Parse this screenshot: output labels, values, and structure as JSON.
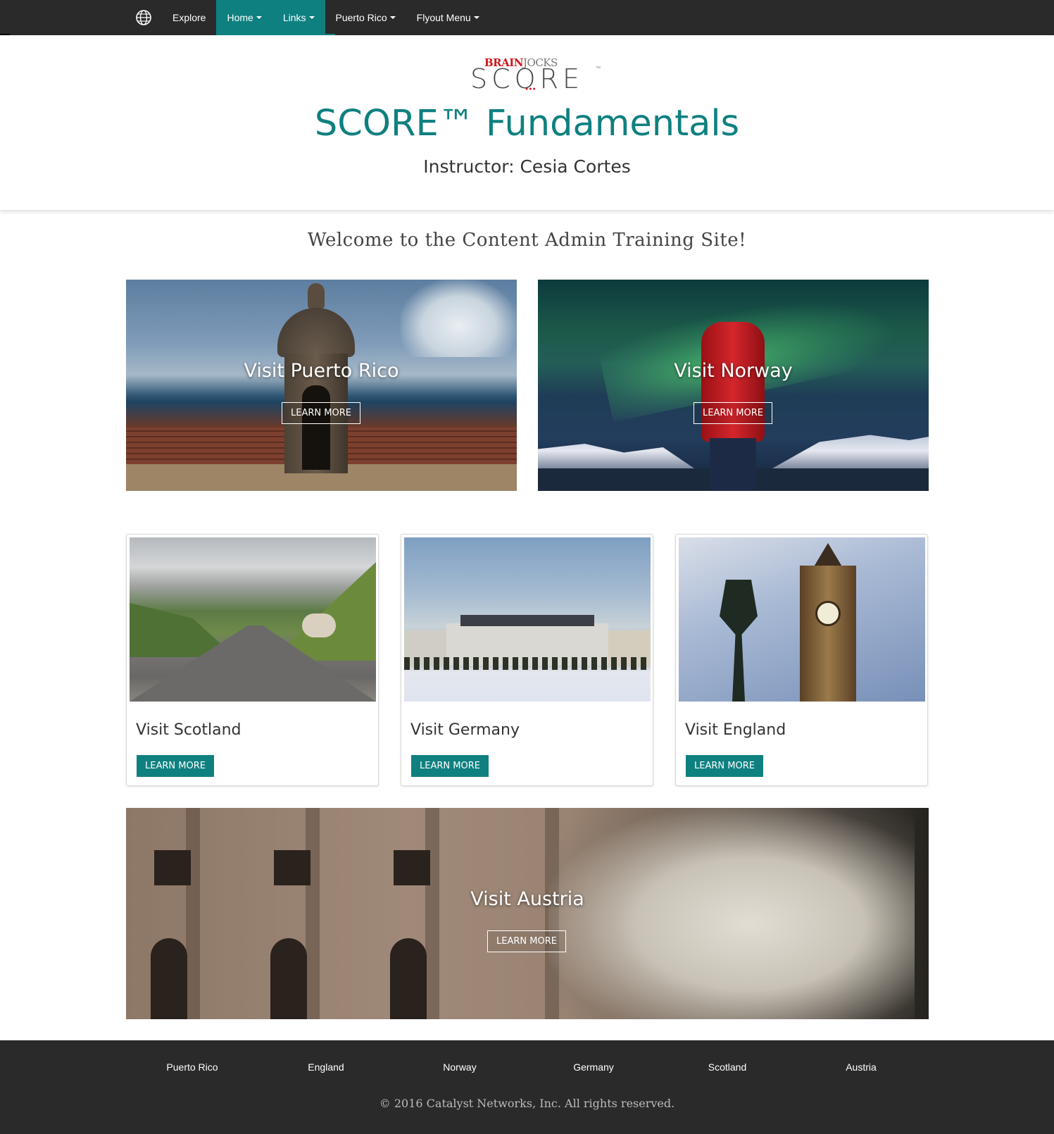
{
  "nav": {
    "logo_icon": "globe-icon",
    "items": [
      {
        "label": "Explore",
        "dropdown": false
      },
      {
        "label": "Home",
        "dropdown": true
      },
      {
        "label": "Links",
        "dropdown": true
      },
      {
        "label": "Puerto Rico",
        "dropdown": true
      },
      {
        "label": "Flyout Menu",
        "dropdown": true
      }
    ],
    "active_items": [
      "Home",
      "Links"
    ]
  },
  "hero": {
    "logo_brain": "BRAIN",
    "logo_jocks": "JOCKS",
    "logo_score": "SCORE",
    "logo_tm": "™",
    "title": "SCORE™ Fundamentals",
    "subtitle": "Instructor: Cesia Cortes"
  },
  "welcome": "Welcome to the Content Admin Training Site!",
  "feature_panels": [
    {
      "title": "Visit Puerto Rico",
      "button": "LEARN MORE"
    },
    {
      "title": "Visit Norway",
      "button": "LEARN MORE"
    }
  ],
  "cards": [
    {
      "title": "Visit Scotland",
      "button": "LEARN MORE"
    },
    {
      "title": "Visit Germany",
      "button": "LEARN MORE"
    },
    {
      "title": "Visit England",
      "button": "LEARN MORE"
    }
  ],
  "wide_panel": {
    "title": "Visit Austria",
    "button": "LEARN MORE"
  },
  "footer": {
    "links": [
      "Puerto Rico",
      "England",
      "Norway",
      "Germany",
      "Scotland",
      "Austria"
    ],
    "copyright": "© 2016 Catalyst Networks, Inc. All rights reserved."
  },
  "colors": {
    "accent": "#0f8080",
    "navbar": "#2a2a2a",
    "brand_red": "#d0161b"
  }
}
